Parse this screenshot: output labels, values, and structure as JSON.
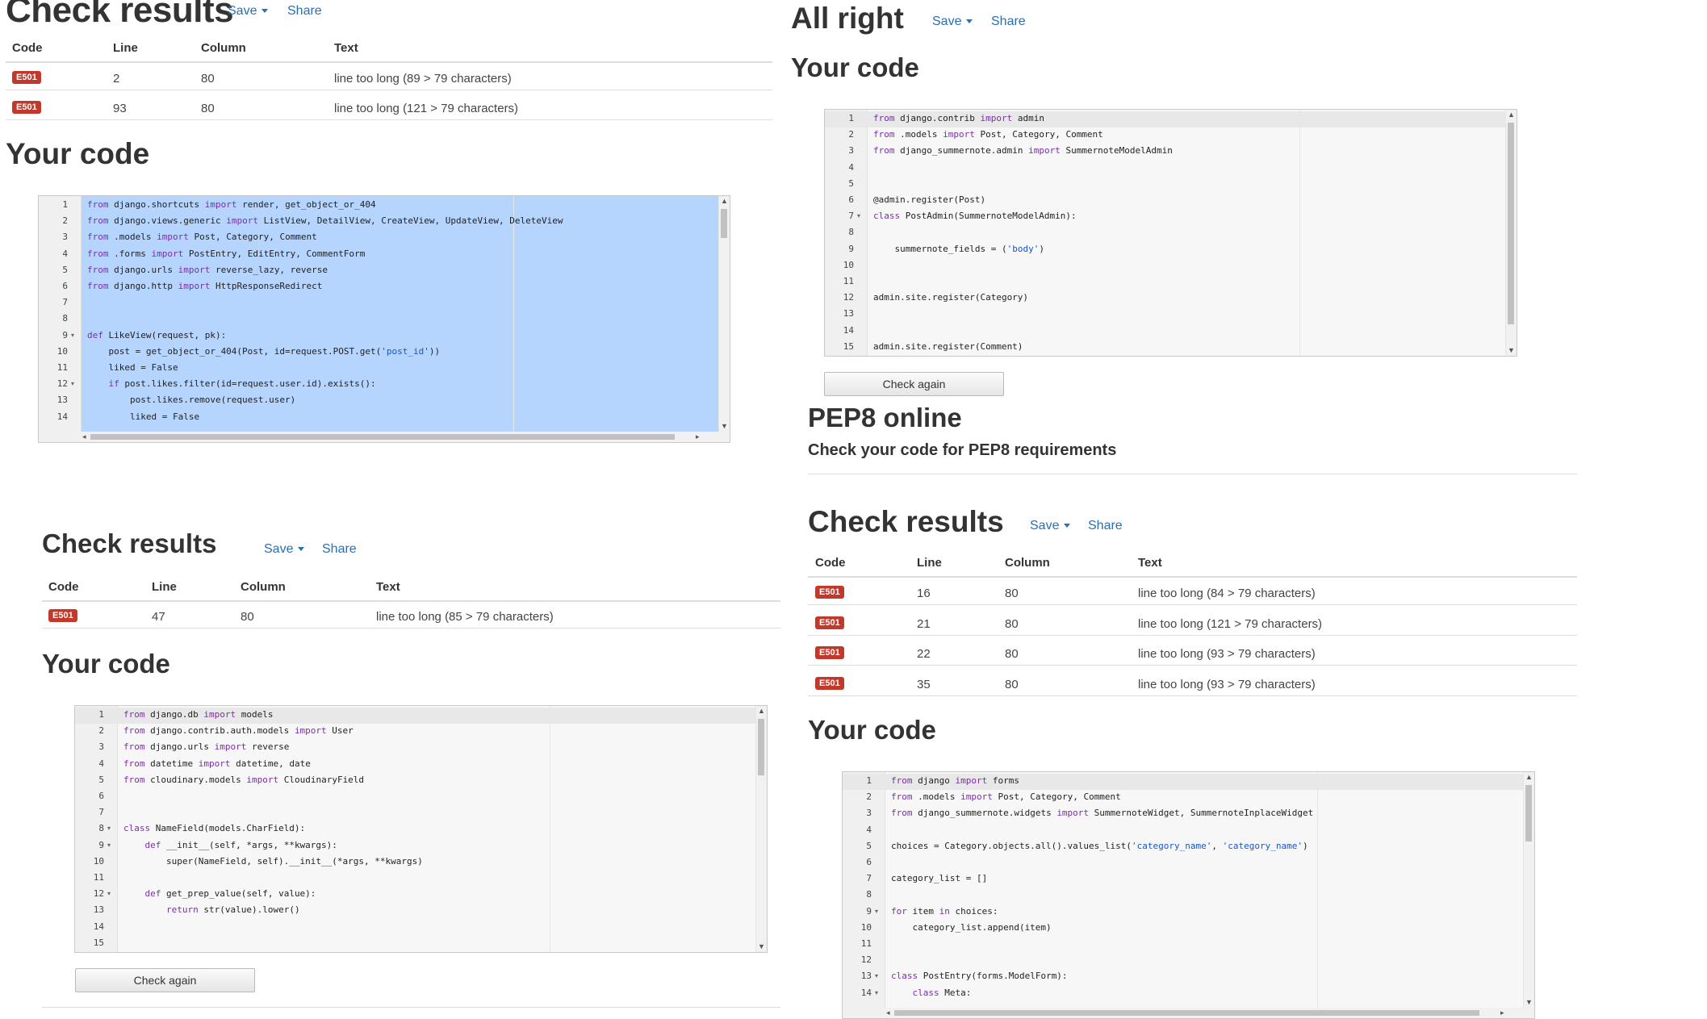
{
  "actions": {
    "save_label": "Save",
    "share_label": "Share",
    "check_again_label": "Check again"
  },
  "table_headers": {
    "code": "Code",
    "line": "Line",
    "column": "Column",
    "text": "Text"
  },
  "headings": {
    "check_results": "Check results",
    "your_code": "Your code",
    "all_right": "All right"
  },
  "pep8": {
    "title": "PEP8 online",
    "subtitle": "Check your code for PEP8 requirements"
  },
  "panel_top_left": {
    "results": [
      {
        "code": "E501",
        "line": "2",
        "column": "80",
        "text": "line too long (89 > 79 characters)"
      },
      {
        "code": "E501",
        "line": "93",
        "column": "80",
        "text": "line too long (121 > 79 characters)"
      }
    ],
    "code_lines": [
      "from django.shortcuts import render, get_object_or_404",
      "from django.views.generic import ListView, DetailView, CreateView, UpdateView, DeleteView",
      "from .models import Post, Category, Comment",
      "from .forms import PostEntry, EditEntry, CommentForm",
      "from django.urls import reverse_lazy, reverse",
      "from django.http import HttpResponseRedirect",
      "",
      "",
      "def LikeView(request, pk):",
      "    post = get_object_or_404(Post, id=request.POST.get('post_id'))",
      "    liked = False",
      "    if post.likes.filter(id=request.user.id).exists():",
      "        post.likes.remove(request.user)",
      "        liked = False",
      ""
    ]
  },
  "panel_bottom_left": {
    "results": [
      {
        "code": "E501",
        "line": "47",
        "column": "80",
        "text": "line too long (85 > 79 characters)"
      }
    ],
    "code_lines": [
      "from django.db import models",
      "from django.contrib.auth.models import User",
      "from django.urls import reverse",
      "from datetime import datetime, date",
      "from cloudinary.models import CloudinaryField",
      "",
      "",
      "class NameField(models.CharField):",
      "    def __init__(self, *args, **kwargs):",
      "        super(NameField, self).__init__(*args, **kwargs)",
      "",
      "    def get_prep_value(self, value):",
      "        return str(value).lower()",
      "",
      ""
    ]
  },
  "panel_top_right": {
    "code_lines": [
      "from django.contrib import admin",
      "from .models import Post, Category, Comment",
      "from django_summernote.admin import SummernoteModelAdmin",
      "",
      "",
      "@admin.register(Post)",
      "class PostAdmin(SummernoteModelAdmin):",
      "",
      "    summernote_fields = ('body')",
      "",
      "",
      "admin.site.register(Category)",
      "",
      "",
      "admin.site.register(Comment)"
    ]
  },
  "panel_bottom_right": {
    "results": [
      {
        "code": "E501",
        "line": "16",
        "column": "80",
        "text": "line too long (84 > 79 characters)"
      },
      {
        "code": "E501",
        "line": "21",
        "column": "80",
        "text": "line too long (121 > 79 characters)"
      },
      {
        "code": "E501",
        "line": "22",
        "column": "80",
        "text": "line too long (93 > 79 characters)"
      },
      {
        "code": "E501",
        "line": "35",
        "column": "80",
        "text": "line too long (93 > 79 characters)"
      }
    ],
    "code_lines": [
      "from django import forms",
      "from .models import Post, Category, Comment",
      "from django_summernote.widgets import SummernoteWidget, SummernoteInplaceWidget",
      "",
      "choices = Category.objects.all().values_list('category_name', 'category_name')",
      "",
      "category_list = []",
      "",
      "for item in choices:",
      "    category_list.append(item)",
      "",
      "",
      "class PostEntry(forms.ModelForm):",
      "    class Meta:",
      ""
    ]
  },
  "colors": {
    "badge": "#c0392b",
    "link": "#2a6fb3",
    "selection": "#b5d5ff",
    "keyword": "#7a2fa8",
    "string": "#1a55c9"
  },
  "icons": [
    "caret-down-icon",
    "fold-arrow-icon",
    "scroll-up-arrow-icon",
    "scroll-down-arrow-icon",
    "scroll-left-arrow-icon",
    "scroll-right-arrow-icon"
  ]
}
